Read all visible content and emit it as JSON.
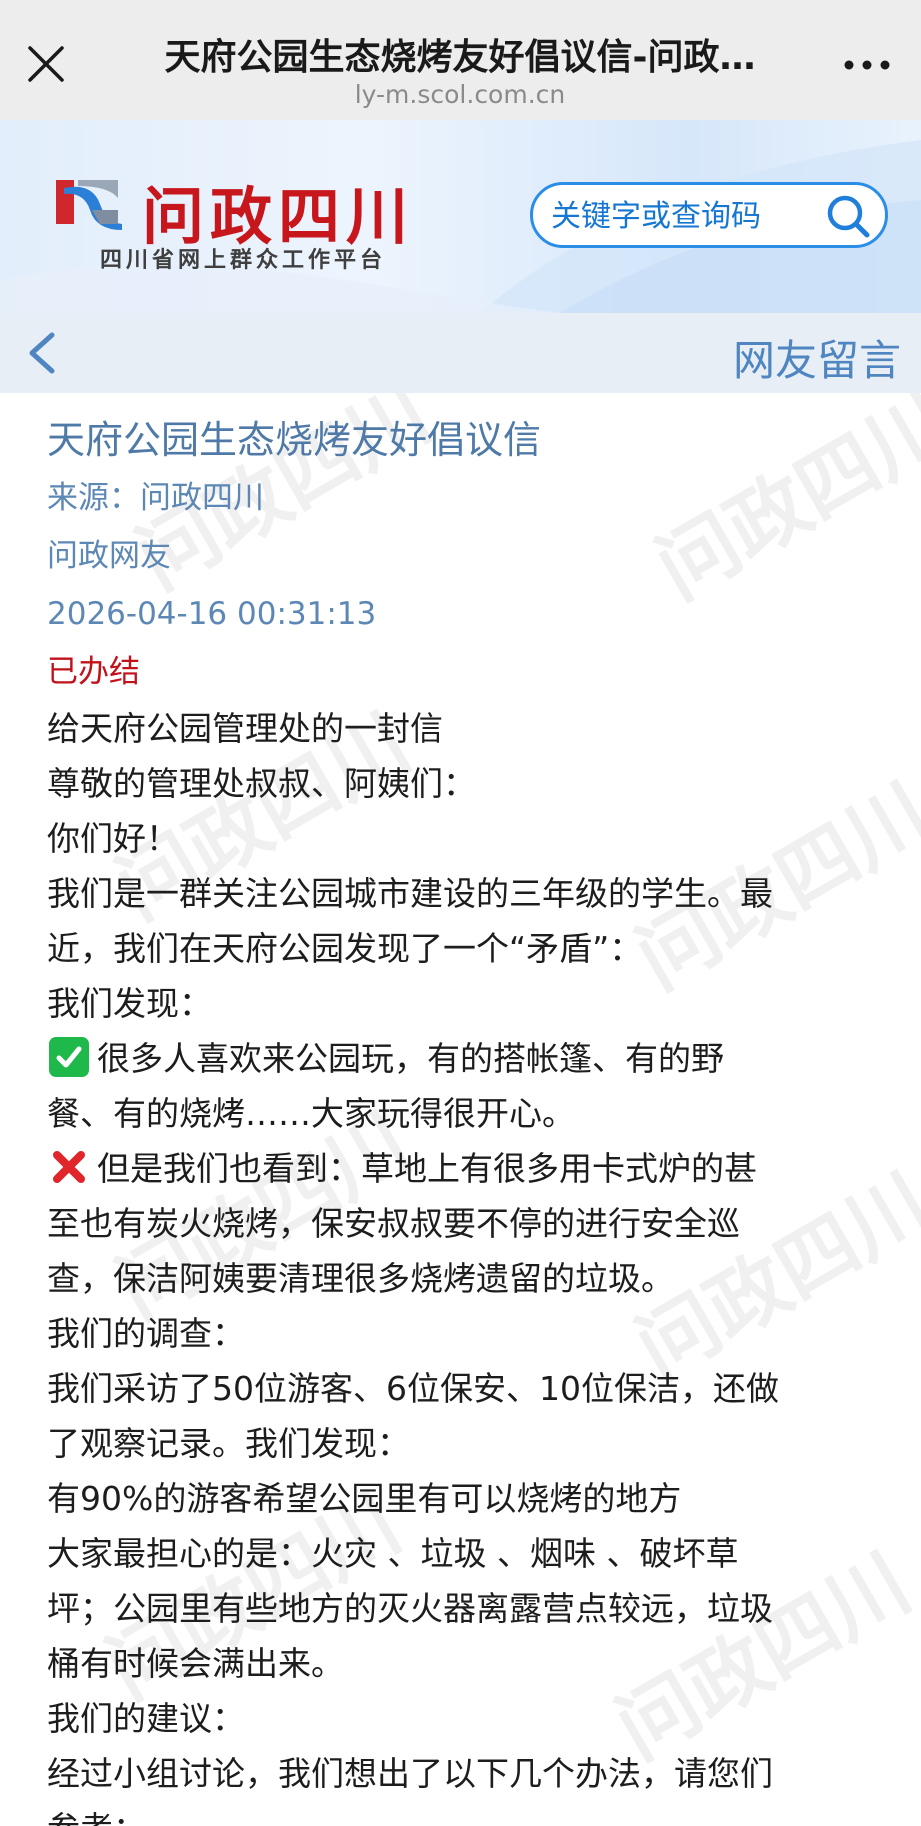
{
  "webview": {
    "title": "天府公园生态烧烤友好倡议信-问政…",
    "url": "ly-m.scol.com.cn"
  },
  "site": {
    "logo_text": "问政四川",
    "logo_subtitle": "四川省网上群众工作平台",
    "search_placeholder": "关键字或查询码",
    "brand_red": "#c8161d",
    "accent_blue": "#2b8ee6"
  },
  "section": {
    "title": "网友留言"
  },
  "watermark": "问政四川",
  "article": {
    "title": "天府公园生态烧烤友好倡议信",
    "source": "来源：问政四川",
    "author": "问政网友",
    "datetime": "2026-04-16 00:31:13",
    "status": "已办结",
    "status_color": "#c0121a",
    "lines": [
      "给天府公园管理处的一封信",
      "尊敬的管理处叔叔、阿姨们：",
      "你们好！",
      "我们是一群关注公园城市建设的三年级的学生。最",
      "近，我们在天府公园发现了一个“矛盾”：",
      "我们发现：",
      "很多人喜欢来公园玩，有的搭帐篷、有的野",
      "餐、有的烧烤……大家玩得很开心。",
      "但是我们也看到：草地上有很多用卡式炉的甚",
      "至也有炭火烧烤，保安叔叔要不停的进行安全巡",
      "查，保洁阿姨要清理很多烧烤遗留的垃圾。",
      "我们的调查：",
      "我们采访了50位游客、6位保安、10位保洁，还做",
      "了观察记录。我们发现：",
      "有90%的游客希望公园里有可以烧烤的地方",
      "大家最担心的是：火灾 、垃圾 、烟味 、破坏草",
      "坪；公园里有些地方的灭火器离露营点较远，垃圾",
      "桶有时候会满出来。",
      "我们的建议：",
      "经过小组讨论，我们想出了以下几个办法，请您们",
      "参考："
    ],
    "emoji_check": "check-mark-emoji",
    "emoji_cross": "cross-mark-emoji"
  }
}
